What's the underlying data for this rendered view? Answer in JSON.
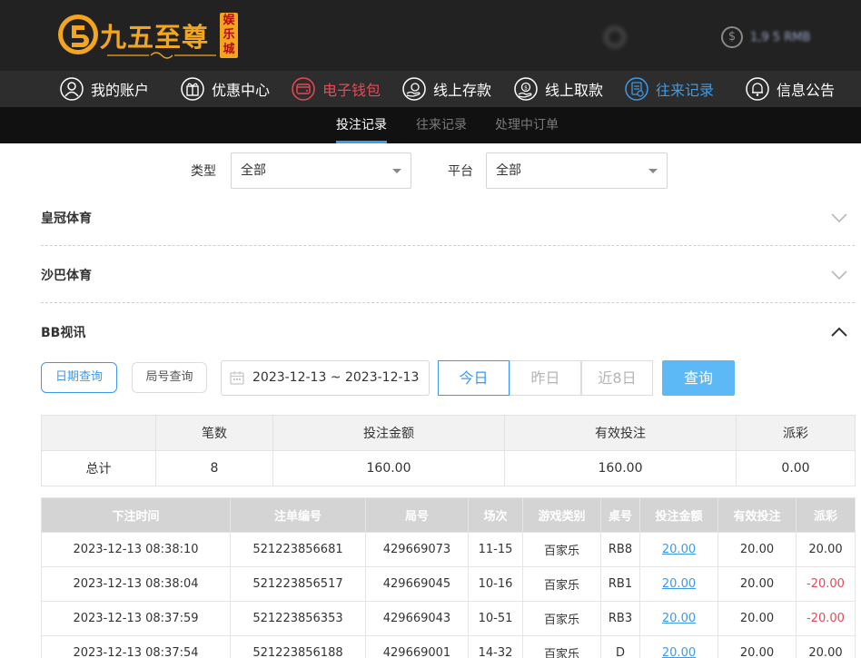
{
  "header": {
    "logo_title": "九五至尊",
    "logo_sub": "娱乐城",
    "balance_text": "1,9   5 RMB",
    "username_text": "      "
  },
  "main_nav": [
    {
      "label": "我的账户",
      "icon": "user-icon"
    },
    {
      "label": "优惠中心",
      "icon": "gift-icon"
    },
    {
      "label": "电子钱包",
      "icon": "wallet-icon",
      "active": true,
      "color": "#e84856"
    },
    {
      "label": "线上存款",
      "icon": "deposit-icon"
    },
    {
      "label": "线上取款",
      "icon": "withdraw-icon"
    },
    {
      "label": "往来记录",
      "icon": "records-icon",
      "color": "#3d9ae8"
    },
    {
      "label": "信息公告",
      "icon": "bell-icon"
    }
  ],
  "sub_nav": [
    {
      "label": "投注记录",
      "active": true
    },
    {
      "label": "往来记录"
    },
    {
      "label": "处理中订单"
    }
  ],
  "filters": {
    "type_label": "类型",
    "type_value": "全部",
    "platform_label": "平台",
    "platform_value": "全部"
  },
  "accordions": [
    {
      "title": "皇冠体育",
      "expanded": false
    },
    {
      "title": "沙巴体育",
      "expanded": false
    },
    {
      "title": "BB视讯",
      "expanded": true
    }
  ],
  "search": {
    "mode_date": "日期查询",
    "mode_round": "局号查询",
    "date_range": "2023-12-13 ~ 2023-12-13",
    "quick": [
      "今日",
      "昨日",
      "近8日"
    ],
    "quick_active": 0,
    "search_label": "查询"
  },
  "summary": {
    "headers": [
      "",
      "笔数",
      "投注金额",
      "有效投注",
      "派彩"
    ],
    "row": [
      "总计",
      "8",
      "160.00",
      "160.00",
      "0.00"
    ]
  },
  "records": {
    "columns": [
      "下注时间",
      "注单编号",
      "局号",
      "场次",
      "游戏类别",
      "桌号",
      "投注金额",
      "有效投注",
      "派彩"
    ],
    "rows": [
      [
        "2023-12-13 08:38:10",
        "521223856681",
        "429669073",
        "11-15",
        "百家乐",
        "RB8",
        "20.00",
        "20.00",
        "20.00"
      ],
      [
        "2023-12-13 08:38:04",
        "521223856517",
        "429669045",
        "10-16",
        "百家乐",
        "RB1",
        "20.00",
        "20.00",
        "-20.00"
      ],
      [
        "2023-12-13 08:37:59",
        "521223856353",
        "429669043",
        "10-51",
        "百家乐",
        "RB3",
        "20.00",
        "20.00",
        "-20.00"
      ],
      [
        "2023-12-13 08:37:54",
        "521223856188",
        "429669001",
        "14-32",
        "百家乐",
        "D",
        "20.00",
        "20.00",
        "20.00"
      ]
    ]
  },
  "colors": {
    "accent_blue": "#3d9ae8",
    "accent_red": "#e84856",
    "logo_gold": "#f3a51f",
    "header_bg": "#222222"
  }
}
